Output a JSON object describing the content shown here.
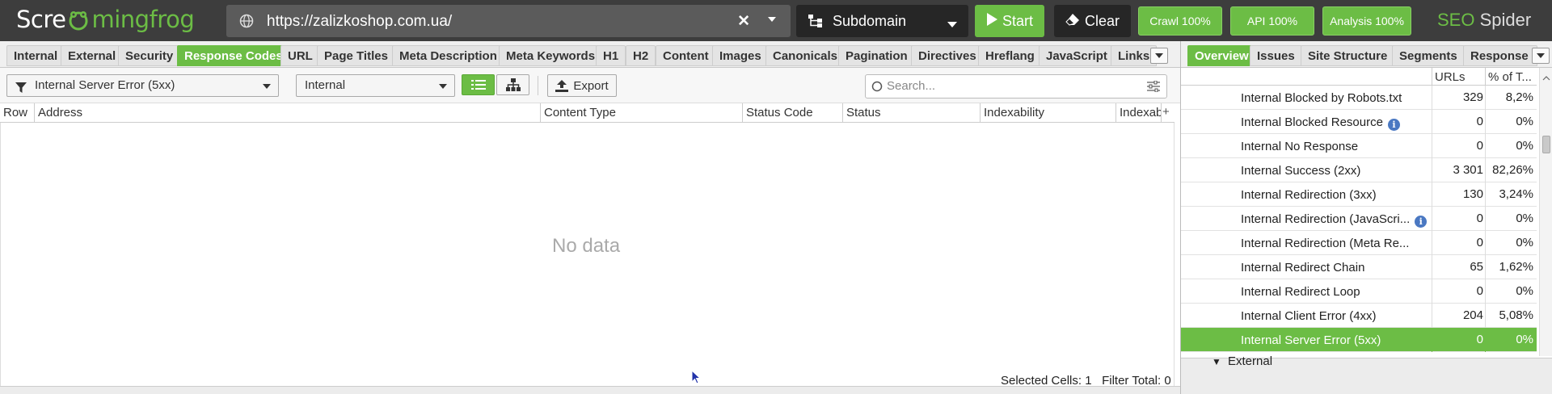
{
  "app": {
    "logo_text_a": "Scre",
    "logo_text_b": "mingfrog",
    "brand_seo": "SEO",
    "brand_spider": "Spider"
  },
  "toolbar": {
    "url": "https://zalizkoshop.com.ua/",
    "mode_label": "Subdomain",
    "start_label": "Start",
    "clear_label": "Clear",
    "crawl_pill": "Crawl 100%",
    "api_pill": "API 100%",
    "analysis_pill": "Analysis 100%"
  },
  "tabs": [
    {
      "label": "Internal"
    },
    {
      "label": "External"
    },
    {
      "label": "Security"
    },
    {
      "label": "Response Codes",
      "active": true
    },
    {
      "label": "URL"
    },
    {
      "label": "Page Titles"
    },
    {
      "label": "Meta Description"
    },
    {
      "label": "Meta Keywords"
    },
    {
      "label": "H1"
    },
    {
      "label": "H2"
    },
    {
      "label": "Content"
    },
    {
      "label": "Images"
    },
    {
      "label": "Canonicals"
    },
    {
      "label": "Pagination"
    },
    {
      "label": "Directives"
    },
    {
      "label": "Hreflang"
    },
    {
      "label": "JavaScript"
    },
    {
      "label": "Links"
    }
  ],
  "filters": {
    "filter_value": "Internal Server Error (5xx)",
    "scope_value": "Internal",
    "export_label": "Export",
    "search_placeholder": "Search..."
  },
  "table": {
    "columns": [
      "Row",
      "Address",
      "Content Type",
      "Status Code",
      "Status",
      "Indexability",
      "Indexab"
    ],
    "empty_text": "No data"
  },
  "status": {
    "selected_cells_label": "Selected Cells:",
    "selected_cells_value": "1",
    "filter_total_label": "Filter Total:",
    "filter_total_value": "0"
  },
  "right_tabs": [
    {
      "label": "Overview",
      "active": true
    },
    {
      "label": "Issues"
    },
    {
      "label": "Site Structure"
    },
    {
      "label": "Segments"
    },
    {
      "label": "Response T"
    }
  ],
  "overview": {
    "col_urls": "URLs",
    "col_pct": "% of T...",
    "rows": [
      {
        "label": "Internal Blocked by Robots.txt",
        "urls": "329",
        "pct": "8,2%"
      },
      {
        "label": "Internal Blocked Resource",
        "urls": "0",
        "pct": "0%",
        "info": true
      },
      {
        "label": "Internal No Response",
        "urls": "0",
        "pct": "0%"
      },
      {
        "label": "Internal Success (2xx)",
        "urls": "3 301",
        "pct": "82,26%"
      },
      {
        "label": "Internal Redirection (3xx)",
        "urls": "130",
        "pct": "3,24%"
      },
      {
        "label": "Internal Redirection (JavaScri...",
        "urls": "0",
        "pct": "0%",
        "info": true
      },
      {
        "label": "Internal Redirection (Meta Re...",
        "urls": "0",
        "pct": "0%"
      },
      {
        "label": "Internal Redirect Chain",
        "urls": "65",
        "pct": "1,62%"
      },
      {
        "label": "Internal Redirect Loop",
        "urls": "0",
        "pct": "0%"
      },
      {
        "label": "Internal Client Error (4xx)",
        "urls": "204",
        "pct": "5,08%"
      },
      {
        "label": "Internal Server Error (5xx)",
        "urls": "0",
        "pct": "0%",
        "selected": true
      }
    ],
    "group_external": "External"
  },
  "colors": {
    "accent": "#6cbd45",
    "topbar": "#3d3d3d",
    "info_icon": "#4a78c2"
  }
}
